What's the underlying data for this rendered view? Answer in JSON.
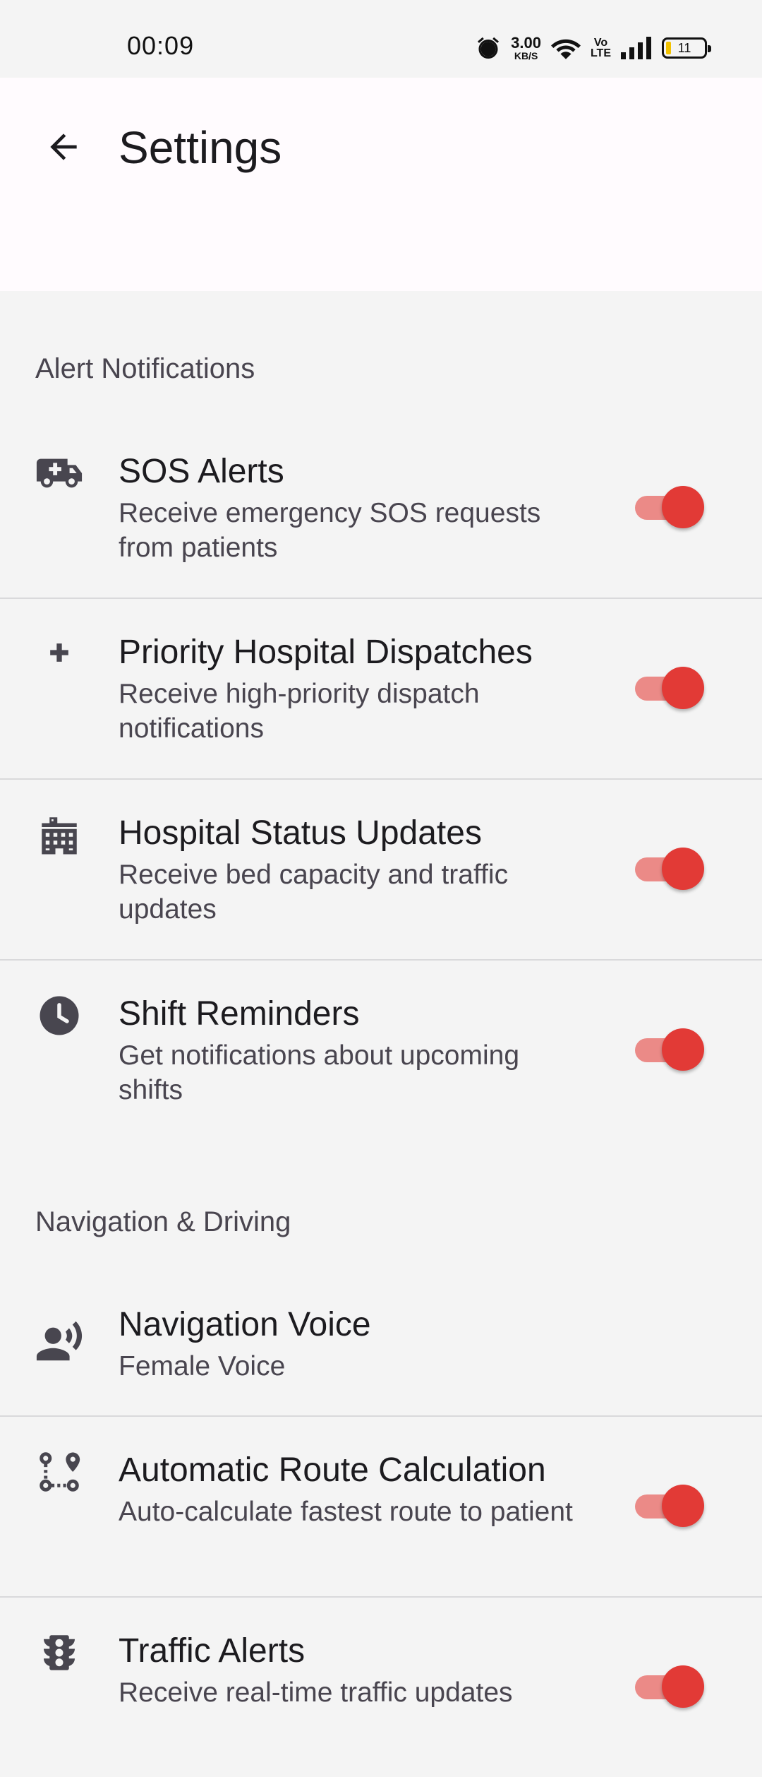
{
  "status_bar": {
    "time": "00:09",
    "net_speed_value": "3.00",
    "net_speed_unit": "KB/S",
    "volte_top": "Vo",
    "volte_bottom": "LTE",
    "battery_level": "11",
    "icons": [
      "alarm-icon",
      "wifi-icon",
      "volte-icon",
      "signal-icon",
      "battery-icon"
    ]
  },
  "app_bar": {
    "title": "Settings",
    "back_icon": "arrow-back-icon"
  },
  "sections": [
    {
      "header": "Alert Notifications",
      "items": [
        {
          "icon": "ambulance-icon",
          "title": "SOS Alerts",
          "subtitle": "Receive emergency SOS requests from patients",
          "toggle": true
        },
        {
          "icon": "medical-cross-icon",
          "title": "Priority Hospital Dispatches",
          "subtitle": "Receive high-priority dispatch notifications",
          "toggle": true
        },
        {
          "icon": "hospital-building-icon",
          "title": "Hospital Status Updates",
          "subtitle": "Receive bed capacity and traffic updates",
          "toggle": true
        },
        {
          "icon": "clock-icon",
          "title": "Shift Reminders",
          "subtitle": "Get notifications about upcoming shifts",
          "toggle": true
        }
      ]
    },
    {
      "header": "Navigation & Driving",
      "items": [
        {
          "icon": "voice-person-icon",
          "title": "Navigation Voice",
          "subtitle": "Female Voice"
        },
        {
          "icon": "route-icon",
          "title": "Automatic Route Calculation",
          "subtitle": "Auto-calculate fastest route to patient",
          "toggle": true
        },
        {
          "icon": "traffic-light-icon",
          "title": "Traffic Alerts",
          "subtitle": "Receive real-time traffic updates",
          "toggle": true
        }
      ]
    }
  ],
  "colors": {
    "switch_thumb": "#e23a36",
    "switch_track": "#eb8a87",
    "app_bar_bg": "#fffbfe",
    "page_bg": "#f4f4f4",
    "icon": "#48464f"
  }
}
